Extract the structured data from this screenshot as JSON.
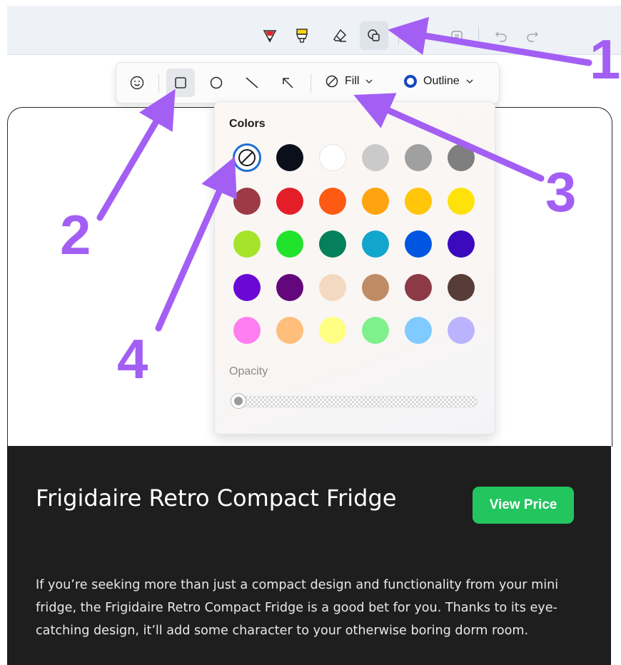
{
  "toolbar": {
    "items": [
      "ballpoint-pen-icon",
      "highlighter-icon",
      "eraser-icon",
      "shapes-icon",
      "ruler-icon",
      "crop-icon",
      "undo-icon",
      "redo-icon"
    ],
    "selected": "shapes-icon"
  },
  "shapes_toolbar": {
    "items": [
      "emoji-icon",
      "rectangle-icon",
      "circle-icon",
      "line-icon",
      "arrow-icon"
    ],
    "selected": "rectangle-icon",
    "fill_label": "Fill",
    "outline_label": "Outline"
  },
  "color_popup": {
    "title": "Colors",
    "selected": "no-color",
    "swatches": [
      [
        "none",
        "#0a0f1a",
        "#ffffff",
        "#cacaca",
        "#a0a0a0",
        "#7f7f7f"
      ],
      [
        "#9c3a46",
        "#e41e26",
        "#ff5a13",
        "#ffa30f",
        "#ffc60a",
        "#ffe20a"
      ],
      [
        "#a6e32b",
        "#22e32b",
        "#05805c",
        "#13a6cc",
        "#0056e0",
        "#3c0abd"
      ],
      [
        "#6a08d6",
        "#64077c",
        "#f4d9c2",
        "#c08c65",
        "#8b3a46",
        "#573c37"
      ],
      [
        "#ff7ef0",
        "#ffbe7b",
        "#ffff84",
        "#7ff08c",
        "#7fcbff",
        "#bcb3ff"
      ]
    ],
    "opacity_label": "Opacity",
    "opacity_value": 0
  },
  "article": {
    "title": "Frigidaire Retro Compact Fridge",
    "button_label": "View Price",
    "description": "If you’re seeking more than just a compact design and functionality from your mini fridge, the Frigidaire Retro Compact Fridge is a good bet for you. Thanks to its eye-catching design, it’ll add some character to your otherwise boring dorm room."
  },
  "annotations": {
    "color": "#a35ff4",
    "labels": [
      "1",
      "2",
      "3",
      "4"
    ]
  },
  "colors": {
    "accent": "#1e6fd0",
    "button_green": "#22c55e",
    "dark_bg": "#1e1e1e"
  }
}
